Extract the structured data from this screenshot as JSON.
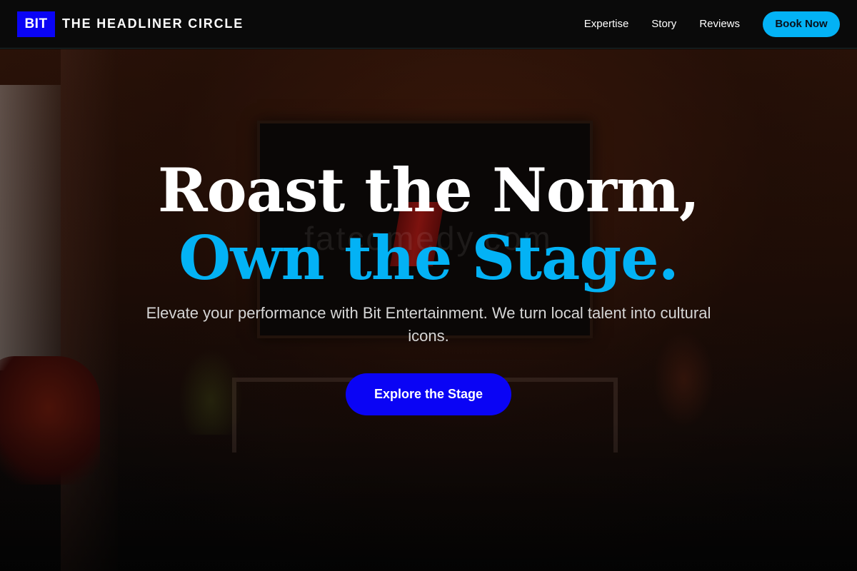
{
  "brand": {
    "logo_text": "BIT",
    "name": "THE HEADLINER CIRCLE"
  },
  "nav": {
    "links": [
      {
        "label": "Expertise"
      },
      {
        "label": "Story"
      },
      {
        "label": "Reviews"
      }
    ],
    "cta_label": "Book Now"
  },
  "hero": {
    "headline_line1": "Roast the Norm,",
    "headline_line2": "Own the Stage.",
    "subtitle": "Elevate your performance with Bit Entertainment. We turn local talent into cultural icons.",
    "cta_label": "Explore the Stage",
    "background_watermark": "fatcomedy.com"
  },
  "colors": {
    "accent_cyan": "#03b2f5",
    "brand_blue": "#0a04f5",
    "nav_background": "#0a0a0a"
  }
}
